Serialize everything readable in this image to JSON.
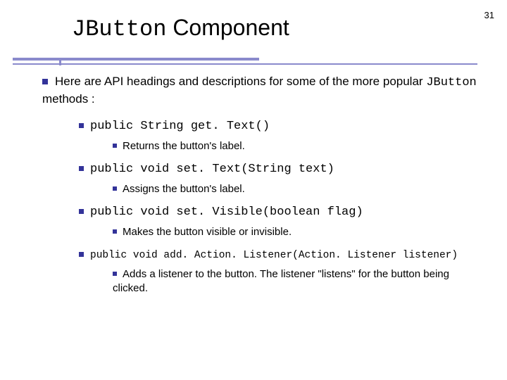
{
  "page_number": "31",
  "title": {
    "mono": "JButton",
    "rest": " Component"
  },
  "intro": {
    "pre": "Here are API headings and descriptions for some of the more popular ",
    "mono": "JButton",
    "post": " methods :"
  },
  "items": [
    {
      "sig": "public String get. Text()",
      "desc": "Returns the button's label.",
      "sig_class": "mono"
    },
    {
      "sig": "public void set. Text(String text)",
      "desc": "Assigns the button's label.",
      "sig_class": "mono"
    },
    {
      "sig": "public void set. Visible(boolean flag)",
      "desc": "Makes the button visible or invisible.",
      "sig_class": "mono"
    },
    {
      "sig": "public void add. Action. Listener(Action. Listener listener)",
      "desc": "Adds a listener to the button. The listener \"listens\" for the button being clicked.",
      "sig_class": "small-mono"
    }
  ]
}
